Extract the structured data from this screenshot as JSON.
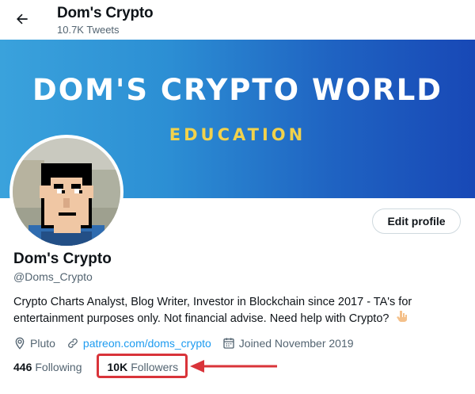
{
  "header": {
    "title": "Dom's Crypto",
    "tweet_count": "10.7K Tweets"
  },
  "banner": {
    "title": "DOM'S CRYPTO WORLD",
    "subtitle": "EDUCATION",
    "colors": {
      "gradient_start": "#3aa2dc",
      "gradient_end": "#1848b6",
      "subtitle": "#f2d24c"
    }
  },
  "profile": {
    "edit_label": "Edit profile",
    "name": "Dom's Crypto",
    "handle": "@Doms_Crypto",
    "bio": "Crypto Charts Analyst, Blog Writer, Investor in Blockchain since 2017 - TA's for entertainment purposes only. Not financial advise. Need help with Crypto?",
    "bio_emoji": "point-down-hand-icon",
    "location": "Pluto",
    "website": "patreon.com/doms_crypto",
    "joined": "Joined November 2019",
    "following_count": "446",
    "following_label": "Following",
    "followers_count": "10K",
    "followers_label": "Followers"
  },
  "annotation": {
    "highlight_color": "#d9343a"
  },
  "colors": {
    "accent": "#1d9bf0",
    "text": "#0f1419",
    "secondary": "#536471"
  }
}
